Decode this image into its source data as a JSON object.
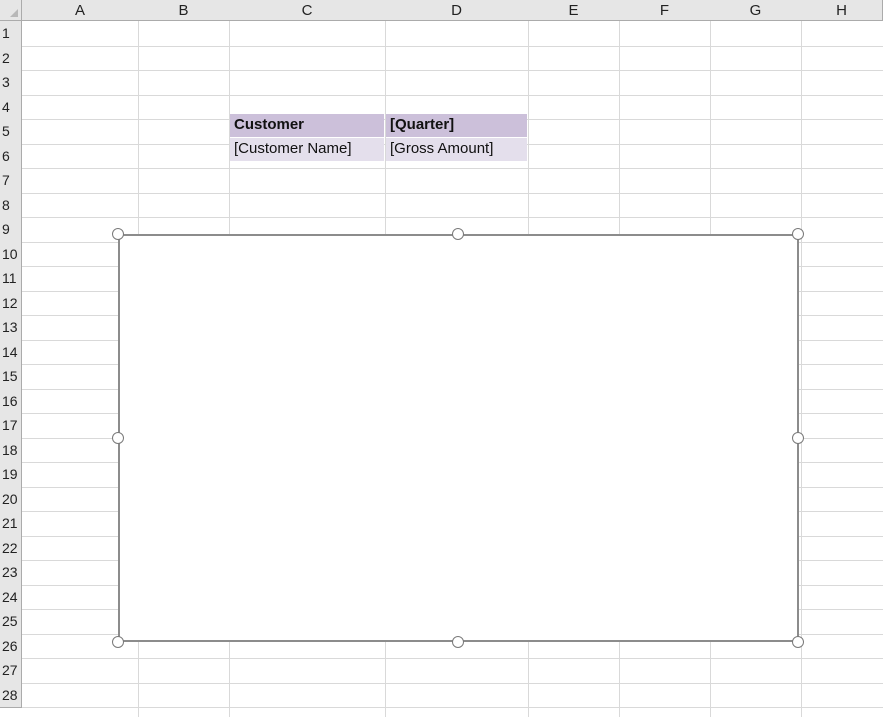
{
  "columns": [
    "A",
    "B",
    "C",
    "D",
    "E",
    "F",
    "G",
    "H"
  ],
  "rows": [
    "1",
    "2",
    "3",
    "4",
    "5",
    "6",
    "7",
    "8",
    "9",
    "10",
    "11",
    "12",
    "13",
    "14",
    "15",
    "16",
    "17",
    "18",
    "19",
    "20",
    "21",
    "22",
    "23",
    "24",
    "25",
    "26",
    "27",
    "28"
  ],
  "cells": {
    "C4": "Customer",
    "D4": "[Quarter]",
    "C5": "[Customer Name]",
    "D5": "[Gross Amount]"
  },
  "colors": {
    "header_fill": "#ccc0da",
    "value_fill": "#e4dfec",
    "gridline": "#d9d9d9",
    "heading_bg": "#e6e6e6"
  },
  "selected_object": "chart"
}
